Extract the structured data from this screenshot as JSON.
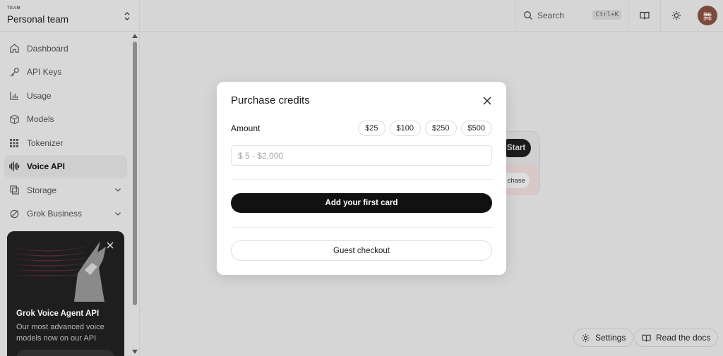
{
  "sidebar": {
    "team_label": "TEAM",
    "team_name": "Personal team",
    "items": [
      {
        "label": "Dashboard",
        "icon": "home-icon"
      },
      {
        "label": "API Keys",
        "icon": "key-icon"
      },
      {
        "label": "Usage",
        "icon": "bar-chart-icon"
      },
      {
        "label": "Models",
        "icon": "cube-icon"
      },
      {
        "label": "Tokenizer",
        "icon": "grid-icon"
      },
      {
        "label": "Voice API",
        "icon": "waveform-icon",
        "active": true
      },
      {
        "label": "Storage",
        "icon": "storage-icon",
        "expandable": true
      },
      {
        "label": "Grok Business",
        "icon": "grok-icon",
        "expandable": true
      }
    ],
    "promo": {
      "title": "Grok Voice Agent API",
      "text": "Our most advanced voice models now on our API"
    }
  },
  "topbar": {
    "search_label": "Search",
    "search_shortcut": "Ctrl+K",
    "avatar_initial": "舞"
  },
  "background": {
    "start_label": "Start",
    "purchase_label": "chase"
  },
  "footer": {
    "settings_label": "Settings",
    "docs_label": "Read the docs"
  },
  "modal": {
    "title": "Purchase credits",
    "amount_label": "Amount",
    "presets": [
      "$25",
      "$100",
      "$250",
      "$500"
    ],
    "amount_placeholder": "$ 5 - $2,000",
    "primary_label": "Add your first card",
    "secondary_label": "Guest checkout"
  },
  "colors": {
    "overlay_bg": "#d6d6d6",
    "primary_button": "#111111",
    "avatar_bg": "#7a4a3a"
  }
}
